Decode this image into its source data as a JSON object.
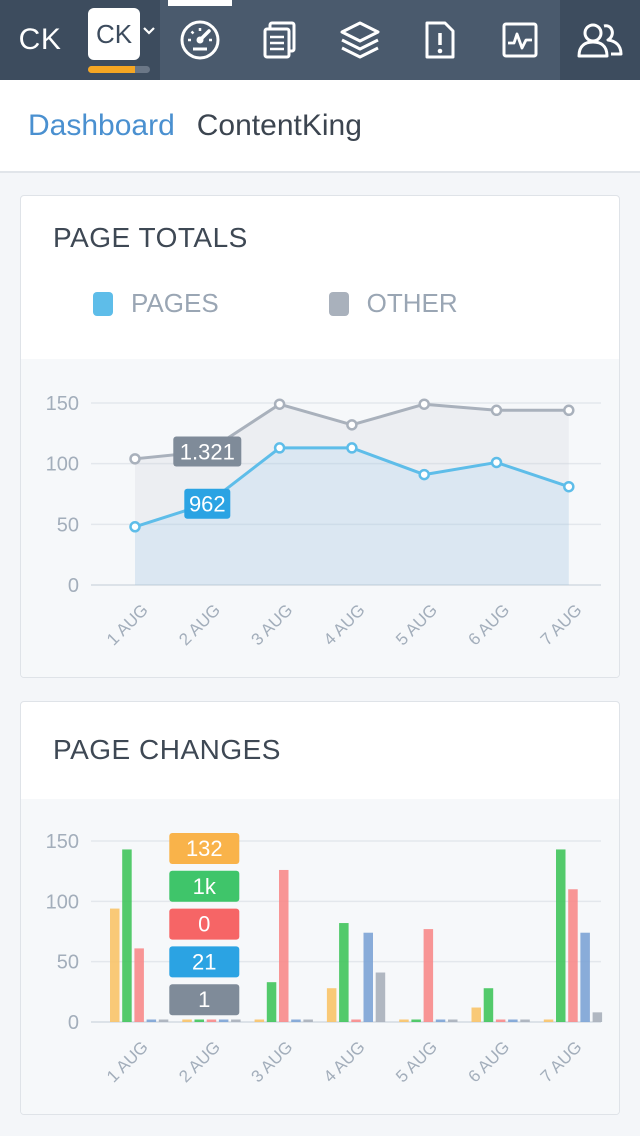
{
  "nav": {
    "brand": "CK",
    "site_badge": "CK",
    "site_progress": 0.75,
    "items": [
      {
        "icon": "dashboard-gauge-icon",
        "active": true
      },
      {
        "icon": "pages-icon",
        "active": false
      },
      {
        "icon": "layers-icon",
        "active": false
      },
      {
        "icon": "issues-icon",
        "active": false
      },
      {
        "icon": "activity-icon",
        "active": false
      }
    ],
    "team_icon": "team-users-icon"
  },
  "breadcrumb": {
    "link": "Dashboard",
    "current": "ContentKing"
  },
  "colors": {
    "pages": "#5ebde9",
    "other": "#a9b1bc",
    "bar_orange": "#f9c46b",
    "bar_green": "#44c55e",
    "bar_red": "#f78c8c",
    "bar_blue": "#7fa5d6",
    "bar_gray": "#a9b1bc"
  },
  "page_totals": {
    "title": "PAGE TOTALS",
    "legend": [
      {
        "label": "PAGES",
        "color": "#5ebde9"
      },
      {
        "label": "OTHER",
        "color": "#a9b1bc"
      }
    ],
    "tooltip": {
      "other": "1.321",
      "pages": "962"
    },
    "chart_data": {
      "type": "line",
      "categories": [
        "1 AUG",
        "2 AUG",
        "3 AUG",
        "4 AUG",
        "5 AUG",
        "6 AUG",
        "7 AUG"
      ],
      "yticks": [
        0,
        50,
        100,
        150
      ],
      "ylim": [
        0,
        150
      ],
      "series": [
        {
          "name": "OTHER",
          "values": [
            104,
            110,
            149,
            132,
            149,
            144,
            144
          ]
        },
        {
          "name": "PAGES",
          "values": [
            48,
            67,
            113,
            113,
            91,
            101,
            81
          ]
        }
      ]
    }
  },
  "page_changes": {
    "title": "PAGE CHANGES",
    "tooltip": [
      "132",
      "1k",
      "0",
      "21",
      "1"
    ],
    "chart_data": {
      "type": "bar",
      "categories": [
        "1 AUG",
        "2 AUG",
        "3 AUG",
        "4 AUG",
        "5 AUG",
        "6 AUG",
        "7 AUG"
      ],
      "yticks": [
        0,
        50,
        100,
        150
      ],
      "ylim": [
        0,
        150
      ],
      "series": [
        {
          "values": [
            94,
            0,
            1,
            28,
            1,
            12,
            1
          ]
        },
        {
          "values": [
            143,
            0,
            33,
            82,
            1,
            28,
            143
          ]
        },
        {
          "values": [
            61,
            0,
            126,
            1,
            77,
            1,
            110
          ]
        },
        {
          "values": [
            1,
            0,
            1,
            74,
            1,
            1,
            74
          ]
        },
        {
          "values": [
            1,
            0,
            1,
            41,
            1,
            1,
            8
          ]
        }
      ]
    }
  }
}
